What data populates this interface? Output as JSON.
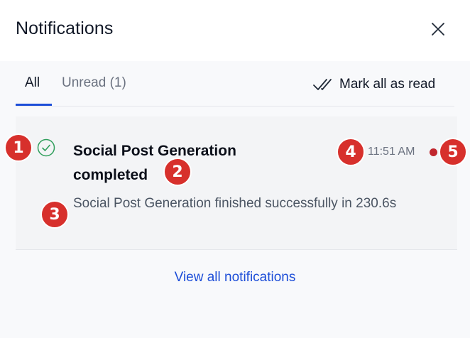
{
  "header": {
    "title": "Notifications",
    "close_icon": "close-icon"
  },
  "tabs": [
    {
      "label": "All",
      "active": true
    },
    {
      "label": "Unread (1)",
      "active": false
    }
  ],
  "toolbar": {
    "mark_all_label": "Mark all as read",
    "mark_all_icon": "double-check-icon"
  },
  "notifications": [
    {
      "status_icon": "check-circle-icon",
      "title": "Social Post Generation completed",
      "message": "Social Post Generation finished successfully in 230.6s",
      "time": "11:51 AM",
      "unread": true
    }
  ],
  "footer": {
    "view_all_label": "View all notifications"
  },
  "markers": [
    "1",
    "2",
    "3",
    "4",
    "5"
  ],
  "colors": {
    "accent": "#1d4ed8",
    "success": "#2f9e5b",
    "unread_dot": "#c0262d",
    "marker": "#d7302c"
  }
}
